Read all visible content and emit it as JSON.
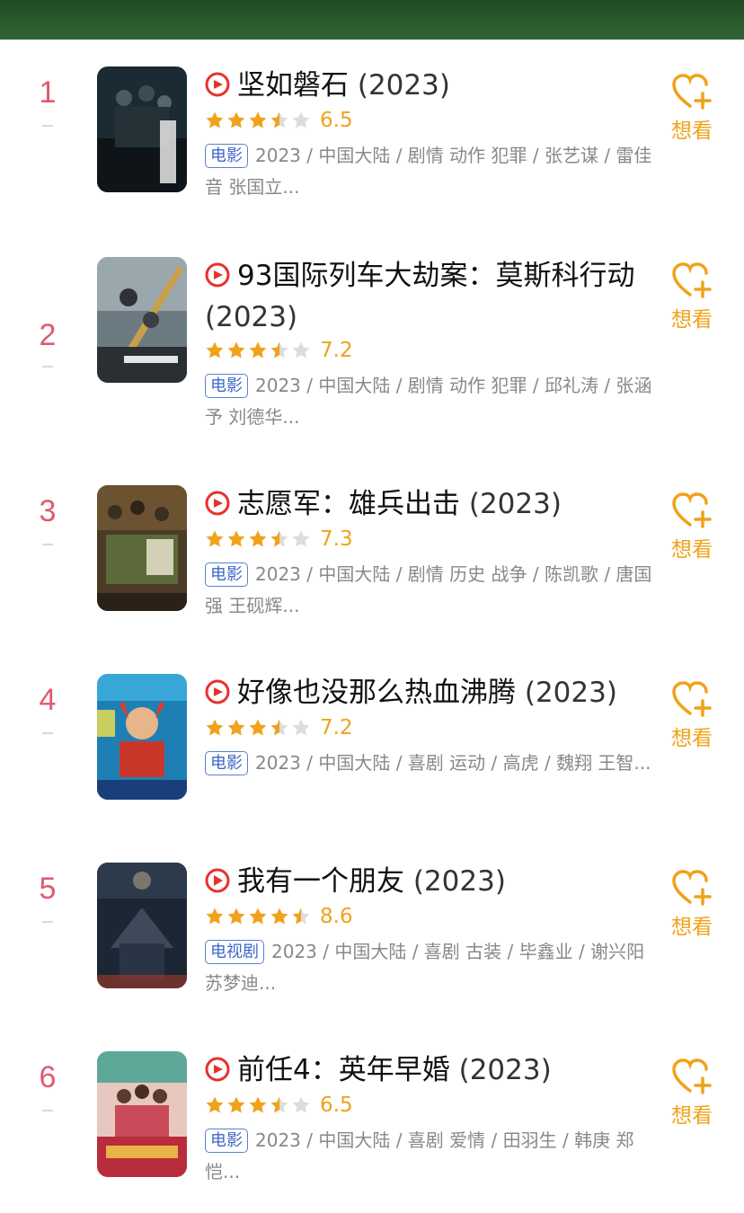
{
  "colors": {
    "accent_orange": "#f0a21a",
    "rank_red": "#e05a6e",
    "tag_blue": "#3f66c8",
    "play_red": "#e8312c",
    "header_green": "#2b5c2f"
  },
  "items": [
    {
      "rank": "1",
      "title": "坚如磐石",
      "year": "(2023)",
      "rating": 3.5,
      "score": "6.5",
      "tag": "电影",
      "meta": "2023 / 中国大陆 / 剧情 动作 犯罪 / 张艺谋 / 雷佳音 张国立...",
      "want_label": "想看",
      "play_icon": "play-circle-icon"
    },
    {
      "rank": "2",
      "title": "93国际列车大劫案：莫斯科行动",
      "year": "(2023)",
      "rating": 3.5,
      "score": "7.2",
      "tag": "电影",
      "meta": "2023 / 中国大陆 / 剧情 动作 犯罪 / 邱礼涛 / 张涵予 刘德华...",
      "want_label": "想看",
      "play_icon": "play-circle-icon"
    },
    {
      "rank": "3",
      "title": "志愿军：雄兵出击",
      "year": "(2023)",
      "rating": 3.5,
      "score": "7.3",
      "tag": "电影",
      "meta": "2023 / 中国大陆 / 剧情 历史 战争 / 陈凯歌 / 唐国强 王砚辉...",
      "want_label": "想看",
      "play_icon": "play-circle-icon"
    },
    {
      "rank": "4",
      "title": "好像也没那么热血沸腾",
      "year": "(2023)",
      "rating": 3.5,
      "score": "7.2",
      "tag": "电影",
      "meta": "2023 / 中国大陆 / 喜剧 运动 / 高虎 / 魏翔 王智...",
      "want_label": "想看",
      "play_icon": "play-circle-icon"
    },
    {
      "rank": "5",
      "title": "我有一个朋友",
      "year": "(2023)",
      "rating": 4.5,
      "score": "8.6",
      "tag": "电视剧",
      "meta": "2023 / 中国大陆 / 喜剧 古装 / 毕鑫业 / 谢兴阳 苏梦迪...",
      "want_label": "想看",
      "play_icon": "play-circle-icon"
    },
    {
      "rank": "6",
      "title": "前任4：英年早婚",
      "year": "(2023)",
      "rating": 3.5,
      "score": "6.5",
      "tag": "电影",
      "meta": "2023 / 中国大陆 / 喜剧 爱情 / 田羽生 / 韩庚 郑恺...",
      "want_label": "想看",
      "play_icon": "play-circle-icon"
    }
  ]
}
